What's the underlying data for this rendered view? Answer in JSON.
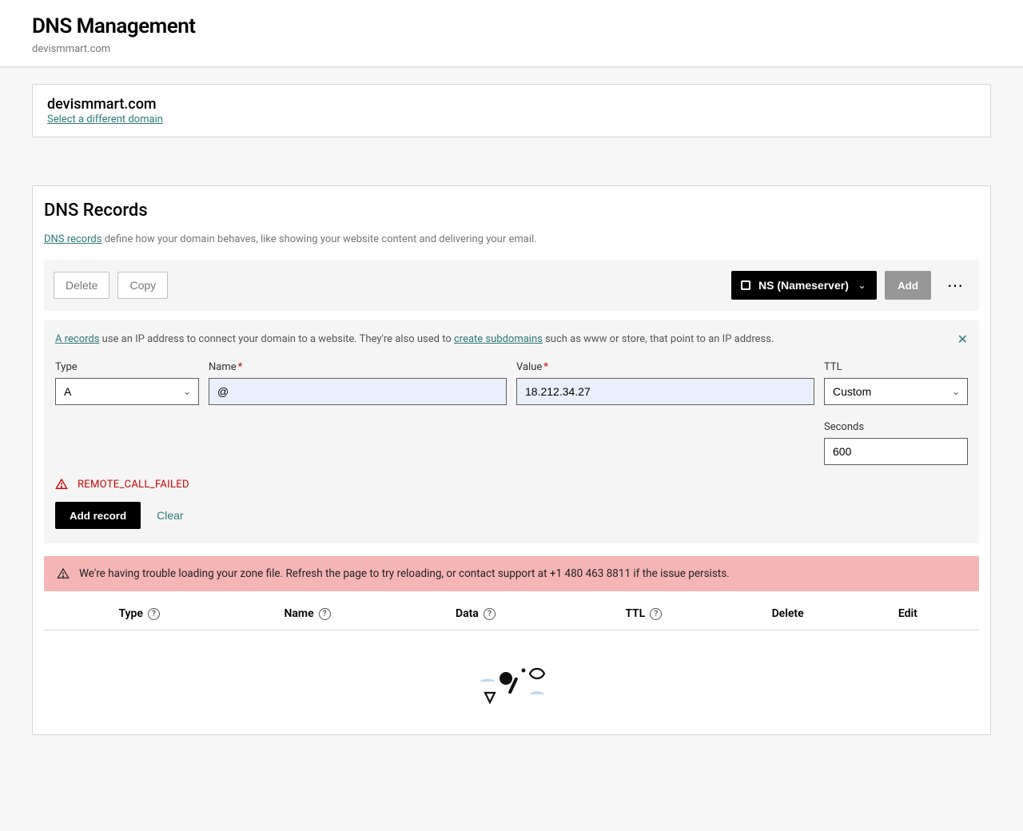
{
  "header": {
    "title": "DNS Management",
    "domain": "devismmart.com"
  },
  "domain_card": {
    "domain": "devismmart.com",
    "select_different": "Select a different domain"
  },
  "records": {
    "title": "DNS Records",
    "desc_link": "DNS records",
    "desc_rest": " define how your domain behaves, like showing your website content and delivering your email.",
    "delete_label": "Delete",
    "copy_label": "Copy",
    "ns_label": "NS (Nameserver)",
    "add_label": "Add",
    "info_link1": "A records",
    "info_mid1": " use an IP address to connect your domain to a website. They're also used to ",
    "info_link2": "create subdomains",
    "info_mid2": " such as www or store, that point to an IP address."
  },
  "form": {
    "type_label": "Type",
    "type_value": "A",
    "name_label": "Name",
    "name_value": "@",
    "value_label": "Value",
    "value_value": "18.212.34.27",
    "ttl_label": "TTL",
    "ttl_value": "Custom",
    "seconds_label": "Seconds",
    "seconds_value": "600",
    "error_text": "REMOTE_CALL_FAILED",
    "add_record_label": "Add record",
    "clear_label": "Clear"
  },
  "alert": {
    "text": "We're having trouble loading your zone file. Refresh the page to try reloading, or contact support at +1 480 463 8811 if the issue persists."
  },
  "table": {
    "type": "Type",
    "name": "Name",
    "data": "Data",
    "ttl": "TTL",
    "delete": "Delete",
    "edit": "Edit"
  }
}
